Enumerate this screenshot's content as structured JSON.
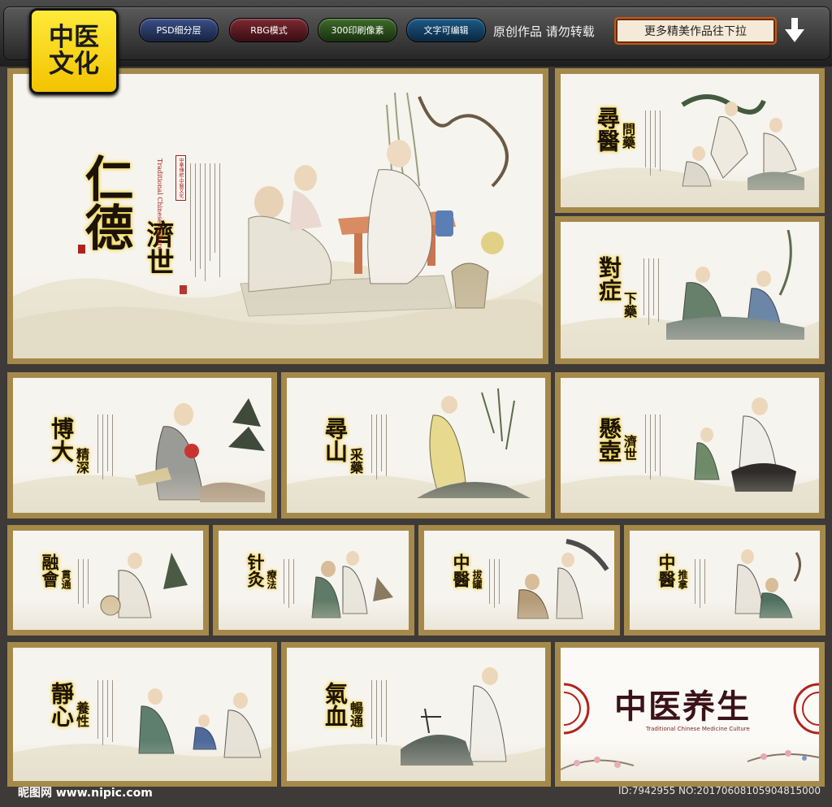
{
  "header": {
    "logo_line1": "中医",
    "logo_line2": "文化",
    "badges": [
      "PSD细分层",
      "RBG模式",
      "300印刷像素",
      "文字可编辑"
    ],
    "original_note": "原创作品 请勿转载",
    "more_button": "更多精美作品往下拉",
    "arrow_icon": "down-arrow-icon"
  },
  "colors": {
    "frame": "#a5894b",
    "background": "#3d3a37",
    "title_glow": "#f2d23b",
    "seal": "#b2221d"
  },
  "panels": [
    {
      "main": "仁德",
      "sub": "濟世",
      "eng": "Traditional Chinese Culture",
      "label": "中華傳統·中醫文化"
    },
    {
      "main": "尋醫",
      "sub": "問藥"
    },
    {
      "main": "對症",
      "sub": "下藥"
    },
    {
      "main": "博大",
      "sub": "精深"
    },
    {
      "main": "尋山",
      "sub": "采藥"
    },
    {
      "main": "懸壺",
      "sub": "濟世"
    },
    {
      "main": "融會",
      "sub": "貫通"
    },
    {
      "main": "针灸",
      "sub": "療法"
    },
    {
      "main": "中醫",
      "sub": "拔罐"
    },
    {
      "main": "中醫",
      "sub": "推拿"
    },
    {
      "main": "靜心",
      "sub": "養性"
    },
    {
      "main": "氣血",
      "sub": "暢通"
    },
    {
      "main": "中医养生",
      "sub": "Traditional Chinese Medicine Culture"
    }
  ],
  "footer": {
    "watermark": "昵图网 www.nipic.com",
    "id_text": "ID:7942955 NO:20170608105904815000"
  }
}
